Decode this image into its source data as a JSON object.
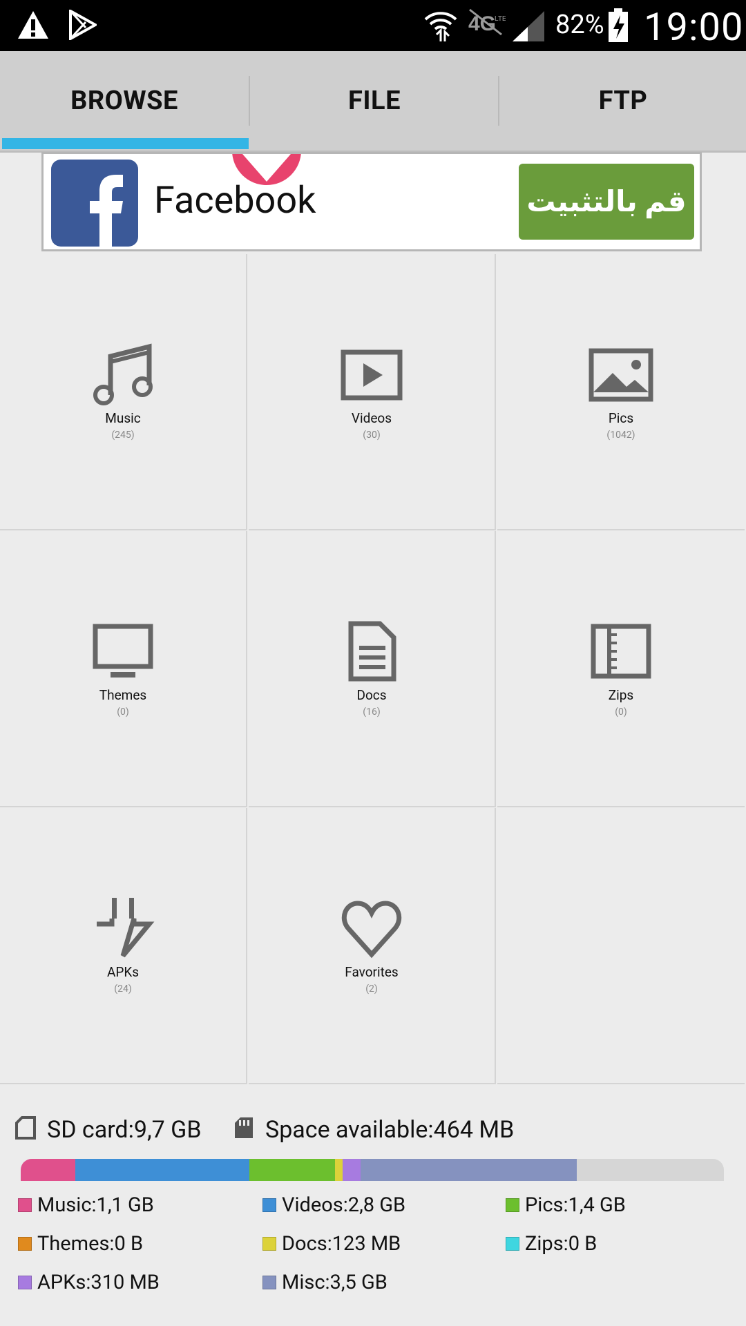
{
  "status_bar": {
    "battery_percent": "82%",
    "time": "19:00"
  },
  "tabs": [
    {
      "label": "BROWSE",
      "active": true
    },
    {
      "label": "FILE",
      "active": false
    },
    {
      "label": "FTP",
      "active": false
    }
  ],
  "ad": {
    "app_name": "Facebook",
    "button_label": "قم بالتثبيت"
  },
  "categories": [
    {
      "label": "Music",
      "count": "(245)",
      "icon": "music-note-icon"
    },
    {
      "label": "Videos",
      "count": "(30)",
      "icon": "play-icon"
    },
    {
      "label": "Pics",
      "count": "(1042)",
      "icon": "image-icon"
    },
    {
      "label": "Themes",
      "count": "(0)",
      "icon": "monitor-icon"
    },
    {
      "label": "Docs",
      "count": "(16)",
      "icon": "document-icon"
    },
    {
      "label": "Zips",
      "count": "(0)",
      "icon": "zip-icon"
    },
    {
      "label": "APKs",
      "count": "(24)",
      "icon": "download-arrow-icon"
    },
    {
      "label": "Favorites",
      "count": "(2)",
      "icon": "heart-icon"
    }
  ],
  "storage": {
    "sd_card": "SD card:9,7 GB",
    "space_available": "Space available:464 MB",
    "bar_segments": [
      {
        "name": "Music",
        "color": "#e0508c",
        "fraction": 0.078
      },
      {
        "name": "Videos",
        "color": "#3e8fd6",
        "fraction": 0.247
      },
      {
        "name": "Pics",
        "color": "#6cbf2e",
        "fraction": 0.122
      },
      {
        "name": "Docs",
        "color": "#dcd23a",
        "fraction": 0.011
      },
      {
        "name": "APKs",
        "color": "#a77be0",
        "fraction": 0.025
      },
      {
        "name": "Misc",
        "color": "#8592bf",
        "fraction": 0.308
      }
    ],
    "legend": [
      {
        "label": "Music:1,1 GB",
        "color": "#e0508c"
      },
      {
        "label": "Videos:2,8 GB",
        "color": "#3e8fd6"
      },
      {
        "label": "Pics:1,4 GB",
        "color": "#6cbf2e"
      },
      {
        "label": "Themes:0 B",
        "color": "#e08a1e"
      },
      {
        "label": "Docs:123 MB",
        "color": "#dcd23a"
      },
      {
        "label": "Zips:0 B",
        "color": "#3fd6e0"
      },
      {
        "label": "APKs:310 MB",
        "color": "#a77be0"
      },
      {
        "label": "Misc:3,5 GB",
        "color": "#8592bf"
      }
    ]
  }
}
